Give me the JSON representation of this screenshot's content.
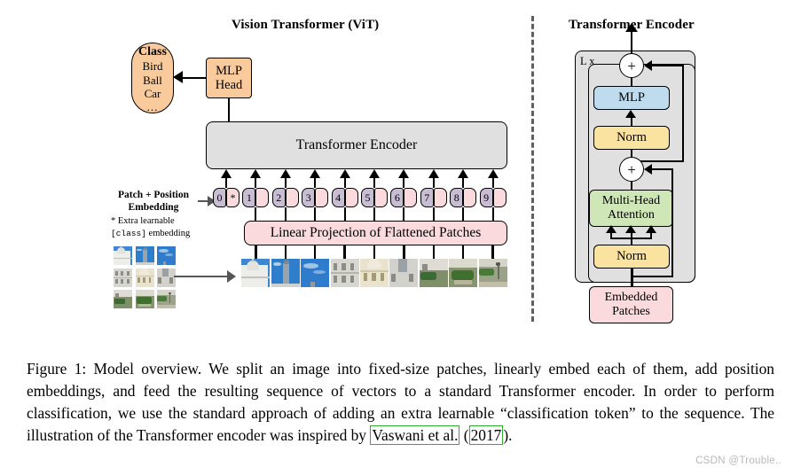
{
  "figure": {
    "left_panel_title": "Vision Transformer (ViT)",
    "right_panel_title": "Transformer Encoder"
  },
  "left_panel": {
    "class_head": {
      "title": "Class",
      "items": [
        "Bird",
        "Ball",
        "Car"
      ],
      "ellipsis": "...",
      "color": "#f9cb9c"
    },
    "mlp_head": {
      "line1": "MLP",
      "line2": "Head",
      "color": "#f9cb9c"
    },
    "encoder_block": {
      "label": "Transformer Encoder",
      "color": "#e0e0e0"
    },
    "embedding_label": {
      "line1": "Patch + Position",
      "line2": "Embedding",
      "note_line1": "* Extra learnable",
      "note_mono": "[class]",
      "note_tail": " embedding"
    },
    "tokens": [
      {
        "pos": "0",
        "patch": "*"
      },
      {
        "pos": "1",
        "patch": ""
      },
      {
        "pos": "2",
        "patch": ""
      },
      {
        "pos": "3",
        "patch": ""
      },
      {
        "pos": "4",
        "patch": ""
      },
      {
        "pos": "5",
        "patch": ""
      },
      {
        "pos": "6",
        "patch": ""
      },
      {
        "pos": "7",
        "patch": ""
      },
      {
        "pos": "8",
        "patch": ""
      },
      {
        "pos": "9",
        "patch": ""
      }
    ],
    "token_colors": {
      "position": "#c9bdd4",
      "patch": "#fadadd"
    },
    "projection": {
      "label": "Linear Projection of Flattened Patches",
      "color": "#fadadd"
    },
    "patch_count": 9
  },
  "right_panel": {
    "repeat_label": "L x",
    "blocks": [
      {
        "label": "MLP",
        "color": "#bfdcee"
      },
      {
        "label": "Norm",
        "color": "#fae3a0"
      },
      {
        "label": "Multi-Head\nAttention",
        "line1": "Multi-Head",
        "line2": "Attention",
        "color": "#cfe6b6"
      },
      {
        "label": "Norm",
        "color": "#fae3a0"
      }
    ],
    "input_block": {
      "line1": "Embedded",
      "line2": "Patches",
      "color": "#fadadd"
    },
    "residual_symbol": "+",
    "container_color": "#e0e0e0"
  },
  "caption": {
    "part1": "Figure 1: Model overview. We split an image into fixed-size patches, linearly embed each of them, add position embeddings, and feed the resulting sequence of vectors to a standard Transformer encoder. In order to perform classification, we use the standard approach of adding an extra learnable “classification token” to the sequence. The illustration of the Transformer encoder was inspired by ",
    "cite_author": "Vaswani et al.",
    "cite_open": " (",
    "cite_year": "2017",
    "cite_close": ").",
    "link_color": "#2fb12f"
  },
  "watermark": {
    "text": "CSDN @Trouble.."
  }
}
